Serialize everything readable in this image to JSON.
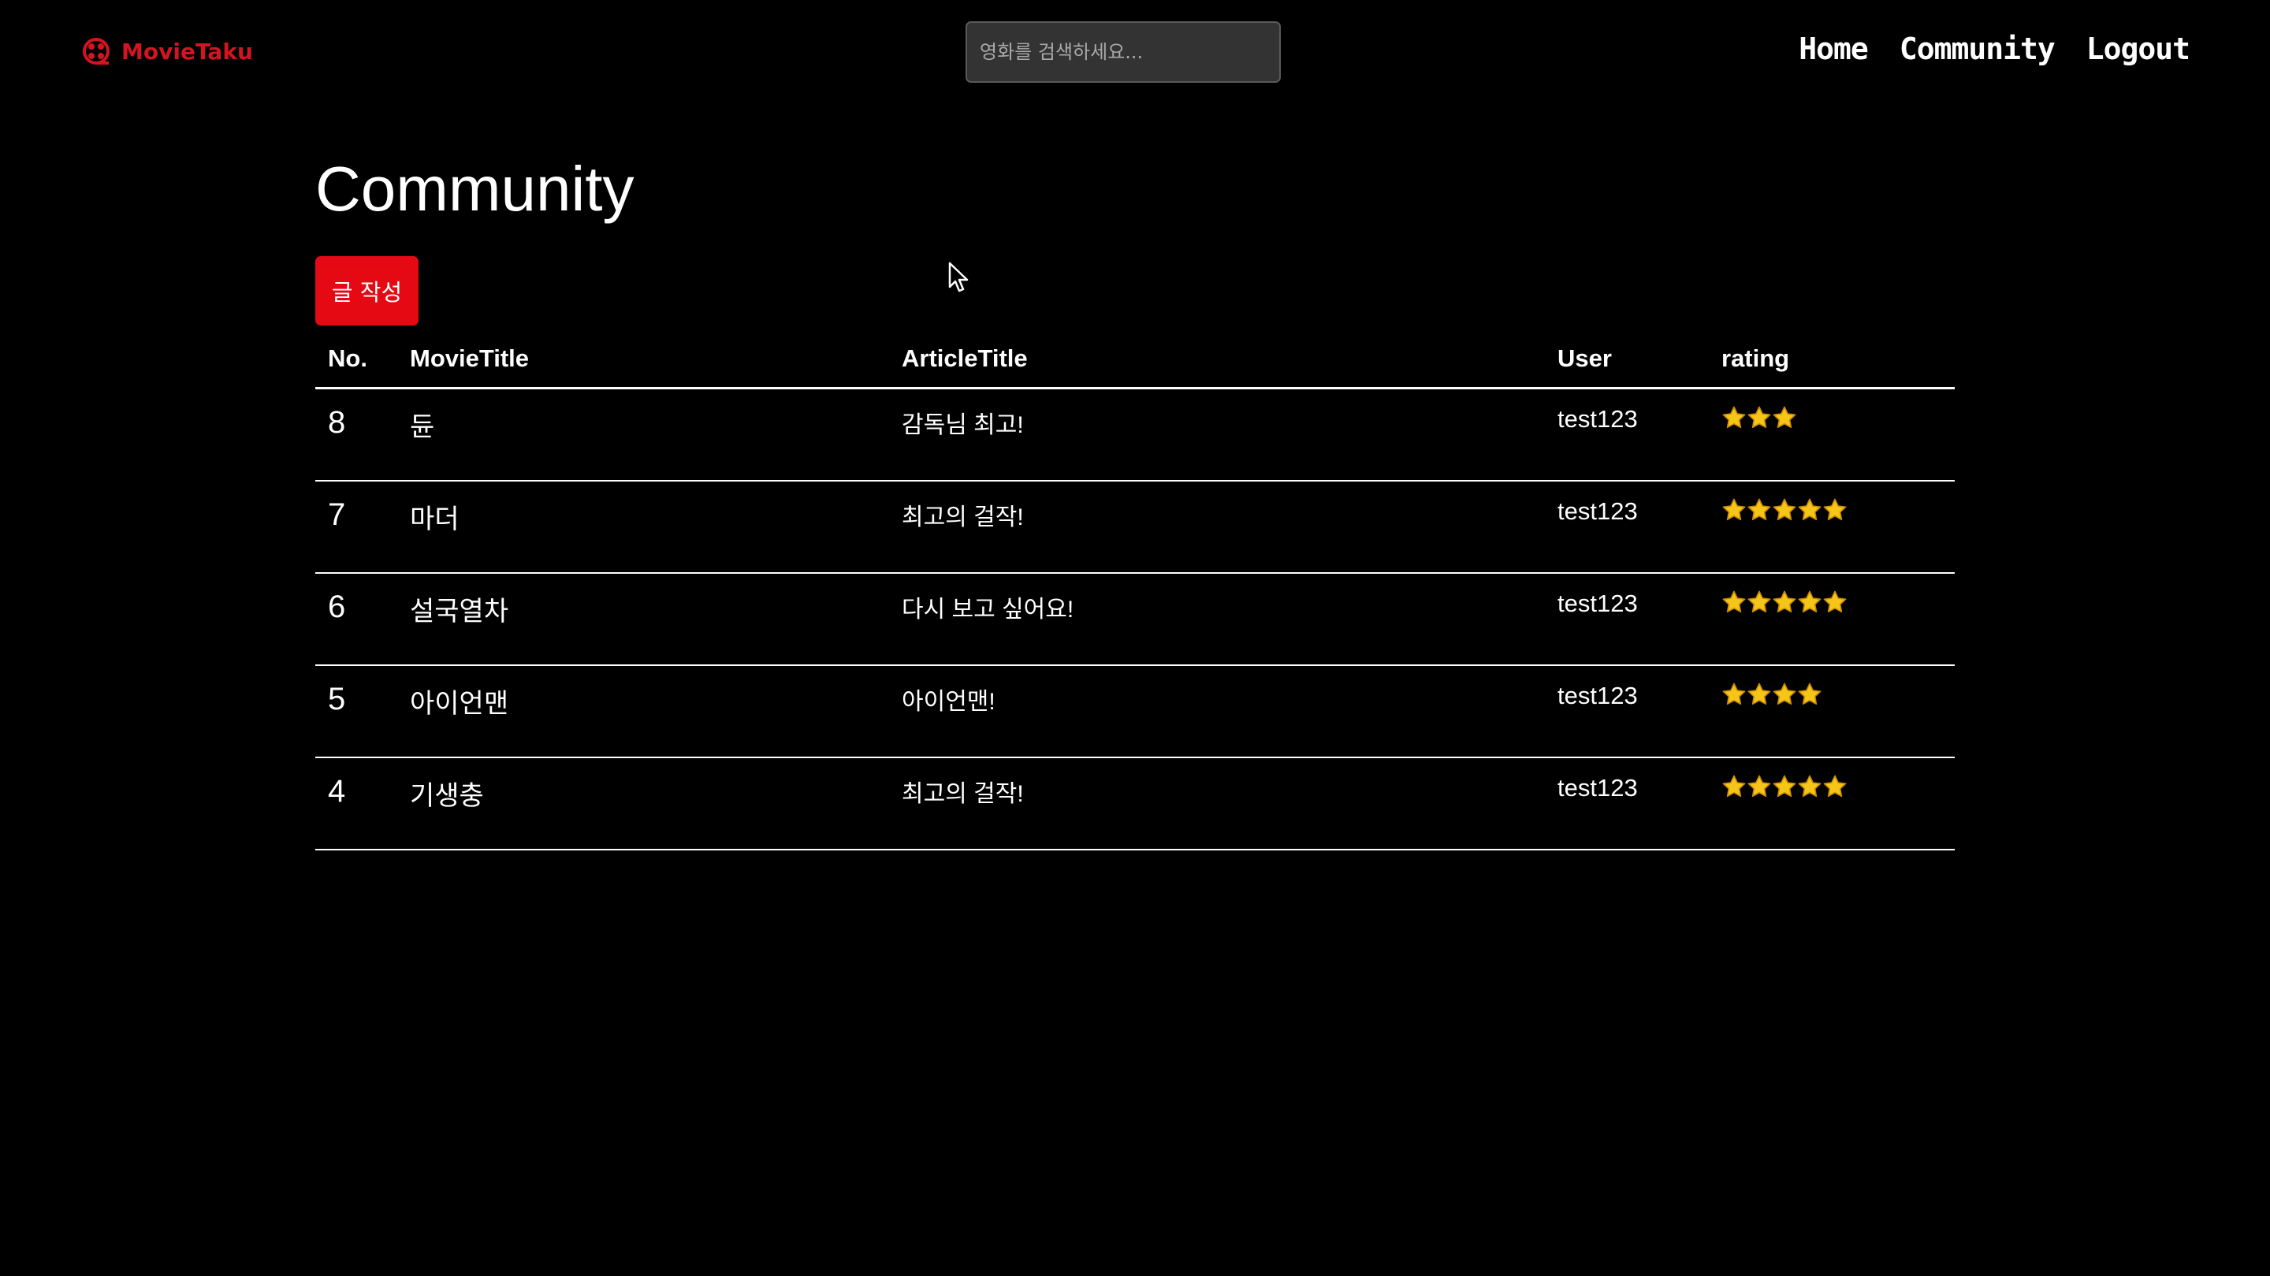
{
  "header": {
    "brand_name": "MovieTaku",
    "brand_color": "#d31421",
    "brand_icon": "film-reel-icon",
    "search_placeholder": "영화를 검색하세요...",
    "nav": [
      {
        "label": "Home"
      },
      {
        "label": "Community"
      },
      {
        "label": "Logout"
      }
    ]
  },
  "main": {
    "title": "Community",
    "write_button_label": "글 작성",
    "write_button_color": "#e50914",
    "table": {
      "columns": [
        "No.",
        "MovieTitle",
        "ArticleTitle",
        "User",
        "rating"
      ],
      "rows": [
        {
          "no": "8",
          "movie": "듄",
          "article": "감독님 최고!",
          "user": "test123",
          "rating": 3
        },
        {
          "no": "7",
          "movie": "마더",
          "article": "최고의 걸작!",
          "user": "test123",
          "rating": 5
        },
        {
          "no": "6",
          "movie": "설국열차",
          "article": "다시 보고 싶어요!",
          "user": "test123",
          "rating": 5
        },
        {
          "no": "5",
          "movie": "아이언맨",
          "article": "아이언맨!",
          "user": "test123",
          "rating": 4
        },
        {
          "no": "4",
          "movie": "기생충",
          "article": "최고의 걸작!",
          "user": "test123",
          "rating": 5
        }
      ]
    },
    "star_icon": "star-icon",
    "star_color": "#f5c518"
  }
}
